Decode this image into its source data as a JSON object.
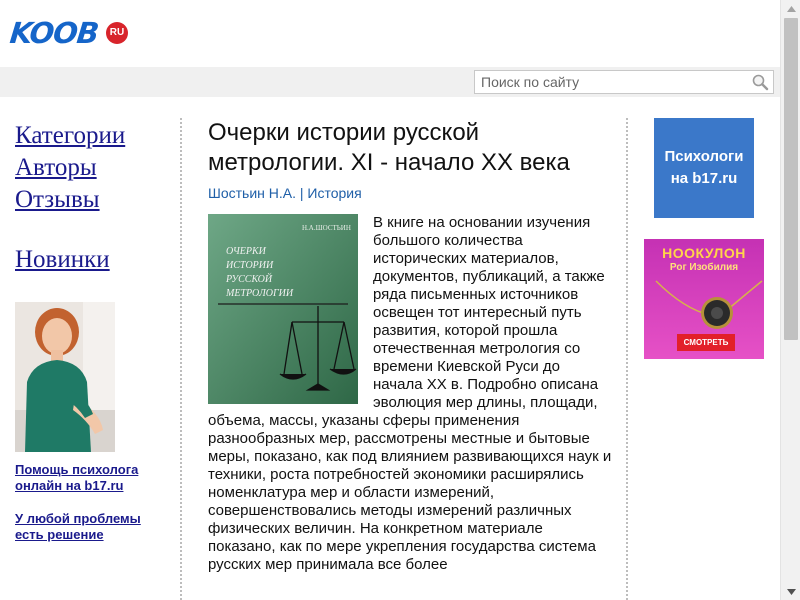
{
  "header": {
    "logo_text": "KOOB",
    "logo_badge": "RU"
  },
  "search": {
    "placeholder": "Поиск по сайту",
    "icon": "search-icon"
  },
  "sidebar": {
    "nav": [
      {
        "label": "Категории"
      },
      {
        "label": "Авторы"
      },
      {
        "label": "Отзывы"
      }
    ],
    "new_label": "Новинки",
    "promo_links": [
      {
        "label": "Помощь психолога онлайн на b17.ru"
      },
      {
        "label": "У любой проблемы есть решение"
      }
    ]
  },
  "book": {
    "title": "Очерки истории русской метрологии. XI - начало XX века",
    "author": "Шостьин Н.А.",
    "separator": " | ",
    "category": "История",
    "cover": {
      "author": "Н.А.ШОСТЬИН",
      "title_lines": [
        "ОЧЕРКИ",
        "ИСТОРИИ",
        "РУССКОЙ",
        "МЕТРОЛОГИИ"
      ]
    },
    "description": "В книге на основании изучения большого количества исторических материалов, документов, публикаций, а также ряда письменных источников освещен тот интересный путь развития, которой прошла отечественная метрология со времени Киевской Руси до начала XX в. Подробно описана эволюция мер длины, площади, объема, массы, указаны сферы применения разнообразных мер, рассмотрены местные и бытовые меры, показано, как под влиянием развивающихся наук и техники, роста потребностей экономики расширялись номенклатура мер и области измерений, совершенствовались методы измерений различных физических величин. На конкретном материале показано, как по мере укрепления государства система русских мер принимала все более"
  },
  "ads": {
    "psych": "Психологи на b17.ru",
    "amulet_title": "НООКУЛОН",
    "amulet_subtitle": "Рог Изобилия",
    "amulet_button": "СМОТРЕТЬ"
  },
  "colors": {
    "logo": "#1565c9",
    "link": "#1a1a8c",
    "meta": "#1f5fa8",
    "cover": "#3e8a5e",
    "psych_ad": "#3b78c9",
    "amulet_ad": "#d53cbd"
  }
}
